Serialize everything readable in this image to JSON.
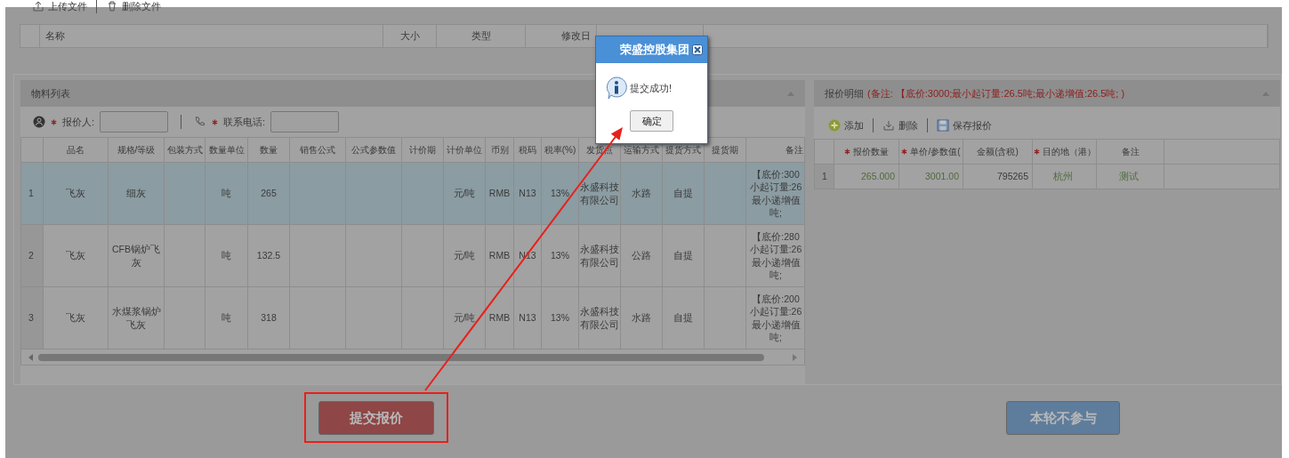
{
  "file_panel": {
    "toolbar": [
      {
        "label": "上传文件"
      },
      {
        "label": "删除文件"
      }
    ],
    "columns": [
      "名称",
      "大小",
      "类型",
      "修改日"
    ]
  },
  "material_panel": {
    "title": "物料列表",
    "fields": [
      {
        "label": "报价人:",
        "required": true
      },
      {
        "label": "联系电话:",
        "required": true
      }
    ],
    "columns": [
      "品名",
      "规格/等级",
      "包装方式",
      "数量单位",
      "数量",
      "销售公式",
      "公式参数值",
      "计价期",
      "计价单位",
      "币别",
      "税码",
      "税率(%)",
      "发货点",
      "运输方式",
      "提货方式",
      "提货期",
      "备注"
    ],
    "rows": [
      {
        "index": "1",
        "selected": true,
        "cells": [
          "飞灰",
          "细灰",
          null,
          "吨",
          "265",
          null,
          null,
          null,
          "元/吨",
          "RMB",
          "N13",
          "13%",
          "永盛科技有限公司",
          "水路",
          "自提",
          null,
          [
            "【底价:300",
            "小起订量:26",
            "最小递增值",
            "吨;"
          ]
        ]
      },
      {
        "index": "2",
        "selected": false,
        "cells": [
          "飞灰",
          "CFB锅炉飞灰",
          null,
          "吨",
          "132.5",
          null,
          null,
          null,
          "元/吨",
          "RMB",
          "N13",
          "13%",
          "永盛科技有限公司",
          "公路",
          "自提",
          null,
          [
            "【底价:280",
            "小起订量:26",
            "最小递增值",
            "吨;"
          ]
        ]
      },
      {
        "index": "3",
        "selected": false,
        "cells": [
          "飞灰",
          "水煤浆锅炉飞灰",
          null,
          "吨",
          "318",
          null,
          null,
          null,
          "元/吨",
          "RMB",
          "N13",
          "13%",
          "永盛科技有限公司",
          "水路",
          "自提",
          null,
          [
            "【底价:200",
            "小起订量:26",
            "最小递增值",
            "吨;"
          ]
        ]
      }
    ]
  },
  "quote_panel": {
    "title": "报价明细",
    "note": "(备注:  【底价:3000;最小起订量:26.5吨;最小递增值:26.5吨; )",
    "toolbar": [
      {
        "label": "添加"
      },
      {
        "label": "删除"
      },
      {
        "label": "保存报价"
      }
    ],
    "columns": [
      {
        "label": "报价数量",
        "required": true,
        "editable": true
      },
      {
        "label": "单价/参数值(",
        "required": true,
        "editable": true
      },
      {
        "label": "金额(含税)",
        "required": false,
        "editable": false
      },
      {
        "label": "目的地（港）",
        "required": true,
        "editable": true
      },
      {
        "label": "备注",
        "required": false,
        "editable": true
      }
    ],
    "rows": [
      {
        "index": "1",
        "cells": [
          "265.000",
          "3001.00",
          "795265",
          "杭州",
          "测试"
        ]
      }
    ]
  },
  "buttons": [
    {
      "label": "提交报价",
      "kind": "danger"
    },
    {
      "label": "本轮不参与",
      "kind": "primary"
    }
  ],
  "dialog": {
    "title": "荣盛控股集团",
    "message": "提交成功!",
    "button": "确定"
  }
}
